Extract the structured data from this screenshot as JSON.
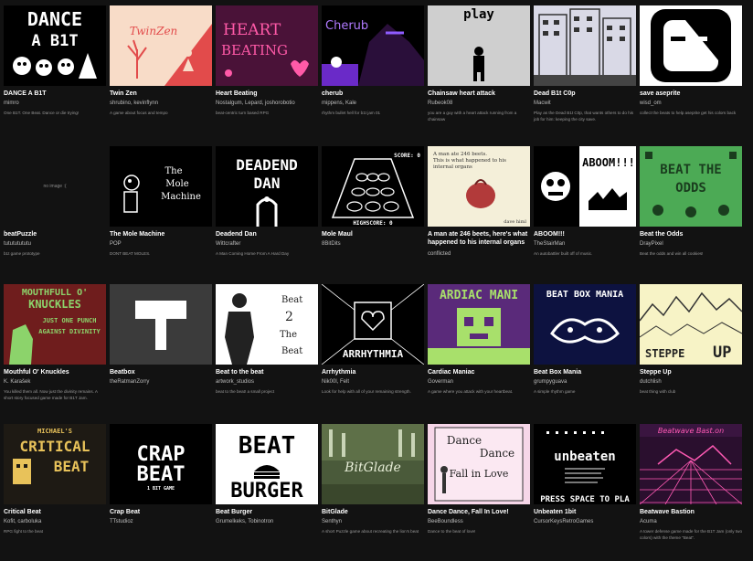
{
  "games": [
    {
      "title": "DANCE A B1T",
      "author": "mimro",
      "desc": "One B1T. One Beat. Dance or die trying!"
    },
    {
      "title": "Twin Zen",
      "author": "shrubino, kevinflynn",
      "desc": "A game about focus and tempo"
    },
    {
      "title": "Heart Beating",
      "author": "Nostalgum, Lepard, joshorobotio",
      "desc": "beat-centric turn based RPG"
    },
    {
      "title": "cherub",
      "author": "mippens, Kale",
      "desc": "rhythm bullet hell for b1t jam 01"
    },
    {
      "title": "Chainsaw heart attack",
      "author": "Rubeok08",
      "desc": "you are a guy with a heart attack running from a chainsaw"
    },
    {
      "title": "Dead B1t C0p",
      "author": "Macwit",
      "desc": "Play as the Dead B1t C0p, that wants others to do his job for him: keeping the city save."
    },
    {
      "title": "save aseprite",
      "author": "wisd_om",
      "desc": "collect the beats to help aseprite get his colors back"
    },
    {
      "title": "beatPuzzle",
      "author": "tutututututu",
      "desc": "b1t game prototype",
      "noimage": "no image :("
    },
    {
      "title": "The Mole Machine",
      "author": "POP",
      "desc": "DONT BEAT MOLES."
    },
    {
      "title": "Deadend Dan",
      "author": "Wittcrafter",
      "desc": "A Man Coming Home From A Hard Day"
    },
    {
      "title": "Mole Maul",
      "author": "8BitDits",
      "desc": ""
    },
    {
      "title": "A man ate 246 beets, here's what happened to his internal organs",
      "author": "conflicted",
      "desc": ""
    },
    {
      "title": "ABOOM!!!",
      "author": "TheStairMan",
      "desc": "An autobattler built off of music."
    },
    {
      "title": "Beat the Odds",
      "author": "DrayPixel",
      "desc": "Beat the odds and win all cookies!"
    },
    {
      "title": "Mouthful O' Knuckles",
      "author": "K. Karašek",
      "desc": "You killed them all. Now just the divinity remains. A short story focused game made for B1T Jam."
    },
    {
      "title": "Beatbox",
      "author": "theRatmanZorry",
      "desc": ""
    },
    {
      "title": "Beat to the beat",
      "author": "artwork_studios",
      "desc": "beat to the beat! a small project"
    },
    {
      "title": "Arrhythmia",
      "author": "Nik00l, Felt",
      "desc": "Look for help with all of your remaining strength."
    },
    {
      "title": "Cardiac Maniac",
      "author": "Goverman",
      "desc": "A game where you attack with your heartbeat."
    },
    {
      "title": "Beat Box Mania",
      "author": "grumpyguava",
      "desc": "A simple rhythm game"
    },
    {
      "title": "Steppe Up",
      "author": "dutchlish",
      "desc": "beat thing with club"
    },
    {
      "title": "Critical Beat",
      "author": "Kofit, carboluka",
      "desc": "RPG fight to the beat"
    },
    {
      "title": "Crap Beat",
      "author": "TTstudioz",
      "desc": ""
    },
    {
      "title": "Beat Burger",
      "author": "Grumelkeks, Tobinotron",
      "desc": ""
    },
    {
      "title": "BitGlade",
      "author": "Senthyn",
      "desc": "A short Puzzle game about recreating the lion's beat"
    },
    {
      "title": "Dance Dance, Fall In Love!",
      "author": "BeeBoundless",
      "desc": "Dance to the beat of love!"
    },
    {
      "title": "Unbeaten 1bit",
      "author": "CursorKeysRetroGames",
      "desc": ""
    },
    {
      "title": "Beatwave Bastion",
      "author": "Acuma",
      "desc": "A tower defense game made for the B1T Jam (only two colors) with the theme \"Beat\"."
    }
  ],
  "thumb_text": {
    "dance_line1": "DANCE",
    "dance_line2": "A B1T",
    "twinzen": "TwinZen",
    "heart1": "HEART",
    "heart2": "BEATING",
    "cherub": "Cherub",
    "play": "play",
    "mole1": "The",
    "mole2": "Mole",
    "mole3": "Machine",
    "deadend1": "DEADEND",
    "deadend2": "DAN",
    "score": "SCORE: 0",
    "highscore": "HIGHSCORE: 0",
    "beets1": "A man ate 246 beets.",
    "beets2": "This is what happened to his",
    "beets3": "internal organs",
    "beets_sig": "dave himl",
    "aboom": "ABOOM!!!",
    "odds1": "BEAT THE",
    "odds2": "ODDS",
    "knuck1": "MOUTHFULL O'",
    "knuck2": "KNUCKLES",
    "knuck3": "JUST ONE PUNCH",
    "knuck4": "AGAINST DIVINITY",
    "btb1": "Beat",
    "btb2": "2",
    "btb3": "The",
    "btb4": "Beat",
    "arr": "ARRHYTHMIA",
    "cardiac": "ARDIAC MANI",
    "bbm": "BEAT BOX MANIA",
    "steppe": "STEPPE",
    "steppe2": "UP",
    "crit0": "MICHAEL'S",
    "crit1": "CRITICAL",
    "crit2": "BEAT",
    "crap1": "CRAP",
    "crap2": "BEAT",
    "crap3": "1 BIT GAME",
    "burg1": "BEAT",
    "burg2": "BURGER",
    "glade": "BitGlade",
    "dd1": "Dance",
    "dd2": "Dance",
    "dd3": "Fall in Love",
    "unb": "unbeaten",
    "unb_press": "PRESS SPACE TO PLA",
    "bw": "Beatwave Bast.on"
  }
}
